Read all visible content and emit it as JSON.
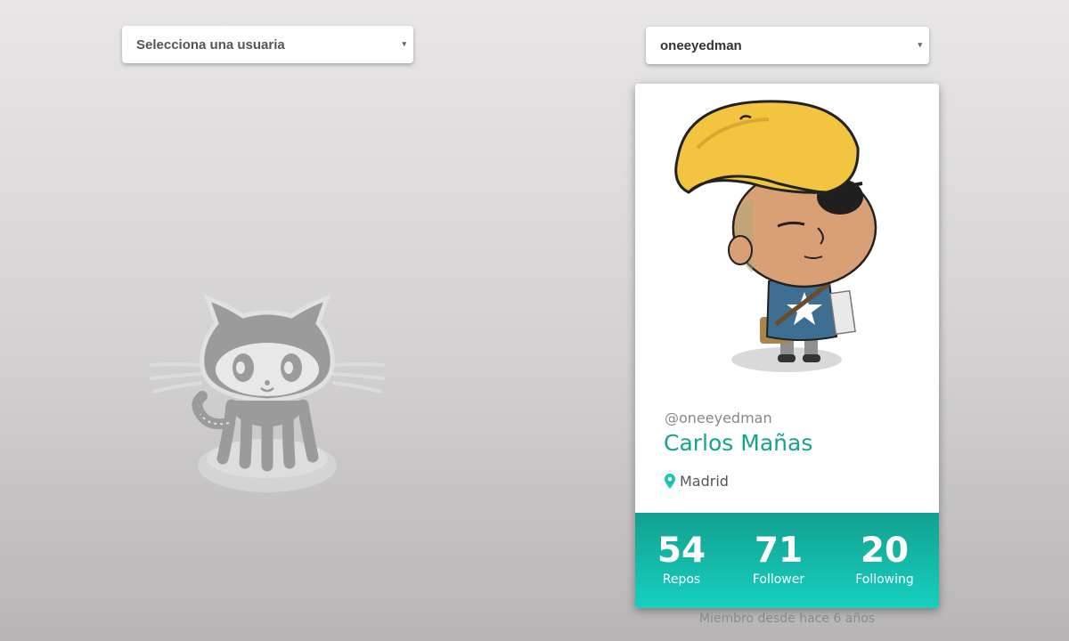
{
  "left_select": {
    "value": "Selecciona una usuaria",
    "arrow": "▾"
  },
  "right_select": {
    "value": "oneeyedman",
    "arrow": "▾"
  },
  "placeholder": {
    "icon": "octocat-icon"
  },
  "profile": {
    "handle": "@oneeyedman",
    "name": "Carlos Mañas",
    "location": "Madrid",
    "location_icon": "map-pin-icon",
    "avatar_icon": "cartoon-avatar-icon",
    "stats": [
      {
        "value": "54",
        "label": "Repos"
      },
      {
        "value": "71",
        "label": "Follower"
      },
      {
        "value": "20",
        "label": "Following"
      }
    ],
    "member_since": "Miembro desde hace 6 años"
  },
  "colors": {
    "accent": "#14a38c",
    "stats_gradient_top": "#12a08f",
    "stats_gradient_bottom": "#16d0c0",
    "pin": "#1bc5b3"
  }
}
